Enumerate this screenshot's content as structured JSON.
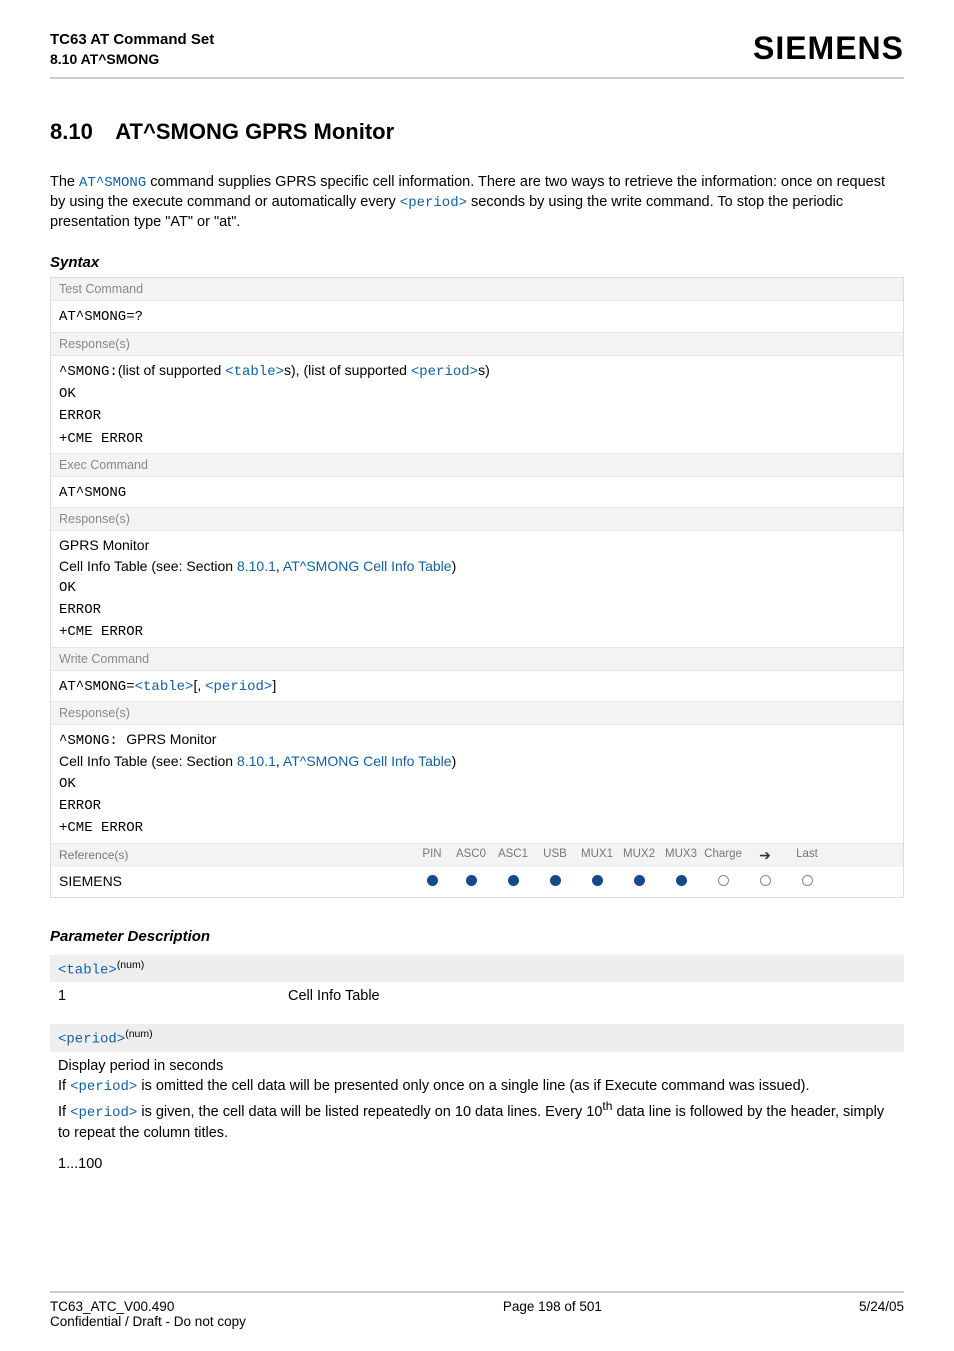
{
  "header": {
    "title": "TC63 AT Command Set",
    "subtitle": "8.10 AT^SMONG",
    "brand": "SIEMENS"
  },
  "section": {
    "number": "8.10",
    "title": "AT^SMONG   GPRS Monitor"
  },
  "intro": {
    "pre": "The ",
    "cmd": "AT^SMONG",
    "mid": " command supplies GPRS specific cell information. There are two ways to retrieve the information: once on request by using the execute command or automatically every ",
    "param": "<period>",
    "post": " seconds by using the write command. To stop the periodic presentation type \"AT\" or \"at\"."
  },
  "syntax_label": "Syntax",
  "test": {
    "label": "Test Command",
    "cmd": "AT^SMONG=?",
    "resp_label": "Response(s)",
    "r1a": "^SMONG:",
    "r1b": "(list of supported ",
    "r1c": "<table>",
    "r1d": "s), (list of supported ",
    "r1e": "<period>",
    "r1f": "s)",
    "r2": "OK",
    "r3": "ERROR",
    "r4": "+CME ERROR"
  },
  "exec": {
    "label": "Exec Command",
    "cmd": "AT^SMONG",
    "resp_label": "Response(s)",
    "r1": "GPRS Monitor",
    "r2a": "Cell Info Table (see: Section ",
    "r2b": "8.10.1",
    "r2c": ", ",
    "r2d": "AT^SMONG Cell Info Table",
    "r2e": ")",
    "r3": "OK",
    "r4": "ERROR",
    "r5": "+CME ERROR"
  },
  "write": {
    "label": "Write Command",
    "cmd_a": "AT^SMONG=",
    "cmd_b": "<table>",
    "cmd_c": "[, ",
    "cmd_d": "<period>",
    "cmd_e": "]",
    "resp_label": "Response(s)",
    "r1a": "^SMONG: ",
    "r1b": "GPRS Monitor",
    "r2a": "Cell Info Table (see: Section ",
    "r2b": "8.10.1",
    "r2c": ", ",
    "r2d": "AT^SMONG Cell Info Table",
    "r2e": ")",
    "r3": "OK",
    "r4": "ERROR",
    "r5": "+CME ERROR"
  },
  "ref": {
    "label": "Reference(s)",
    "vendor": "SIEMENS",
    "cols": [
      "PIN",
      "ASC0",
      "ASC1",
      "USB",
      "MUX1",
      "MUX2",
      "MUX3",
      "Charge",
      "➔",
      "Last"
    ],
    "dots": [
      "filled",
      "filled",
      "filled",
      "filled",
      "filled",
      "filled",
      "filled",
      "empty",
      "empty",
      "empty"
    ]
  },
  "param_title": "Parameter Description",
  "p_table": {
    "name": "<table>",
    "sup": "(num)",
    "row_key": "1",
    "row_val": "Cell Info Table"
  },
  "p_period": {
    "name": "<period>",
    "sup": "(num)",
    "l1": "Display period in seconds",
    "l2a": "If ",
    "l2b": "<period>",
    "l2c": " is omitted the cell data will be presented only once on a single line (as if Execute command was issued).",
    "l3a": "If ",
    "l3b": "<period>",
    "l3c": " is given, the cell data will be listed repeatedly on 10 data lines. Every 10",
    "l3d": "th",
    "l3e": "  data line is followed by the header, simply to repeat the column titles.",
    "range": "1...100"
  },
  "footer": {
    "left1": "TC63_ATC_V00.490",
    "left2": "Confidential / Draft - Do not copy",
    "center": "Page 198 of 501",
    "right": "5/24/05"
  }
}
